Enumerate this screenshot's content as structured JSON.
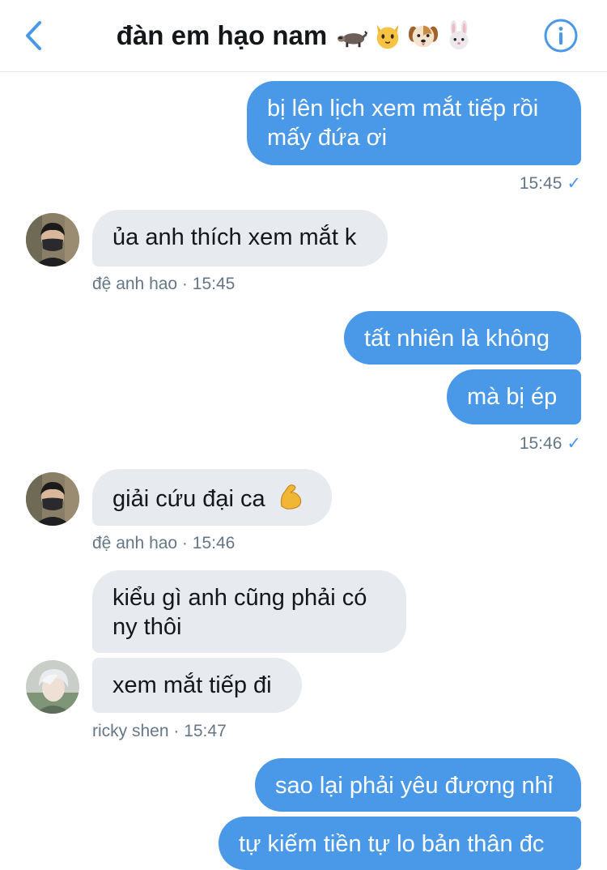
{
  "header": {
    "title": "đàn em hạo nam",
    "emojis": [
      "raccoon-emoji",
      "cat-face-emoji",
      "dog-face-emoji",
      "rabbit-face-emoji"
    ],
    "back_icon": "chevron-left-icon",
    "info_icon": "info-circle-icon"
  },
  "colors": {
    "accent": "#4a99e9",
    "outgoing_bubble": "#4a99e9",
    "incoming_bubble": "#e7ebf0",
    "meta_text": "#657786"
  },
  "messages": {
    "m1": {
      "line1": "bị lên lịch xem mắt tiếp rồi",
      "line2": "mấy đứa ơi",
      "time": "15:45",
      "status": "✓"
    },
    "m2": {
      "text": "ủa anh thích xem mắt k",
      "meta": "đệ anh hao · 15:45"
    },
    "m3": {
      "text": "tất nhiên là không"
    },
    "m4": {
      "text": "mà bị ép",
      "time": "15:46",
      "status": "✓"
    },
    "m5": {
      "text": "giải cứu đại ca",
      "emoji": "flexed-biceps-emoji",
      "meta": "đệ anh hao · 15:46"
    },
    "m6": {
      "line1": "kiểu gì anh cũng phải có",
      "line2": "ny thôi"
    },
    "m7": {
      "text": "xem mắt tiếp đi",
      "meta": "ricky shen · 15:47"
    },
    "m8": {
      "text": "sao lại phải yêu đương nhỉ"
    },
    "m9": {
      "text": "tự kiếm tiền tự lo bản thân đc"
    }
  }
}
